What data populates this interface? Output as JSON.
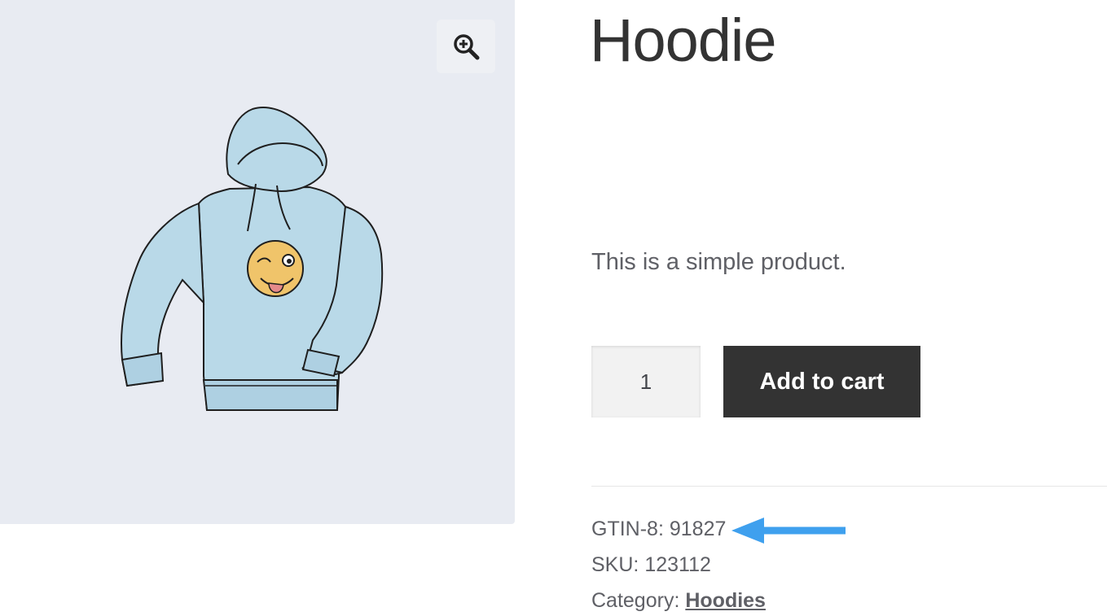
{
  "product": {
    "title": "Hoodie",
    "description": "This is a simple product.",
    "quantity": "1",
    "add_to_cart_label": "Add to cart",
    "image_icon": "hoodie-illustration",
    "zoom_icon": "magnify-plus-icon"
  },
  "meta": {
    "gtin_label": "GTIN-8:",
    "gtin_value": "91827",
    "sku_label": "SKU:",
    "sku_value": "123112",
    "category_label": "Category:",
    "category_value": "Hoodies"
  },
  "annotation": {
    "arrow_color": "#3fa0ee"
  },
  "colors": {
    "gallery_bg": "#e8ebf2",
    "button_bg": "#333333",
    "button_text": "#ffffff"
  }
}
